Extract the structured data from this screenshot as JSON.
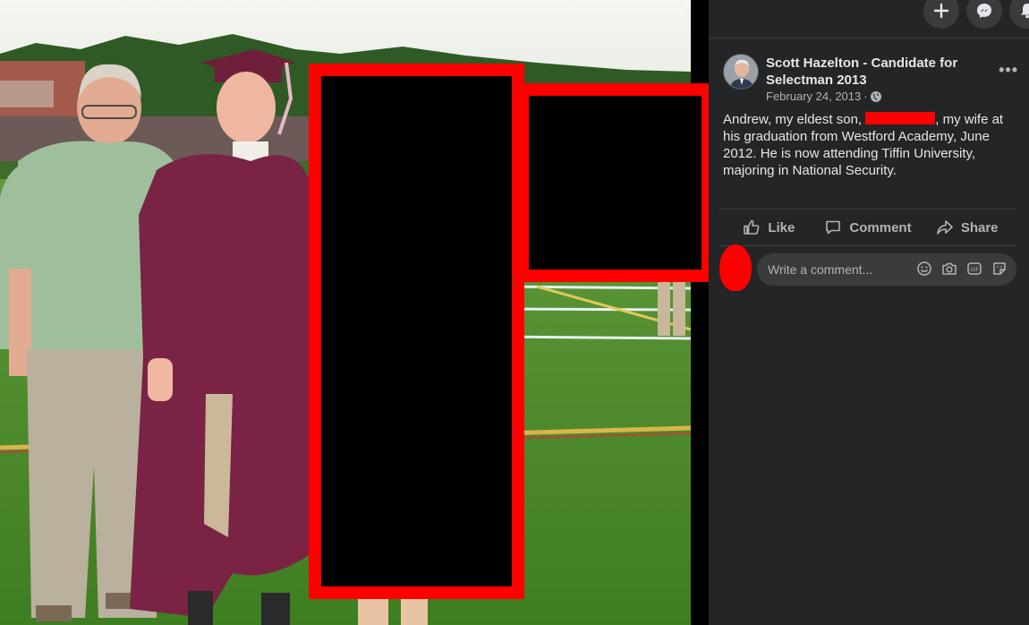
{
  "topbar": {
    "buttons": [
      "plus-icon",
      "messenger-icon",
      "bell-icon"
    ]
  },
  "post": {
    "author": "Scott Hazelton - Candidate for Selectman 2013",
    "date": "February 24, 2013",
    "separator": "·",
    "privacy_icon": "globe-icon",
    "more_label": "•••",
    "caption_before": "Andrew, my eldest son,",
    "caption_after": ", my wife at his graduation from Westford Academy, June 2012. He is now attending Tiffin University, majoring in National Security."
  },
  "actions": {
    "like": "Like",
    "comment": "Comment",
    "share": "Share"
  },
  "comment_input": {
    "placeholder": "Write a comment..."
  },
  "colors": {
    "panel_bg": "#242526",
    "text": "#e4e6eb",
    "muted": "#b0b3b8",
    "redaction": "#ff0000"
  }
}
